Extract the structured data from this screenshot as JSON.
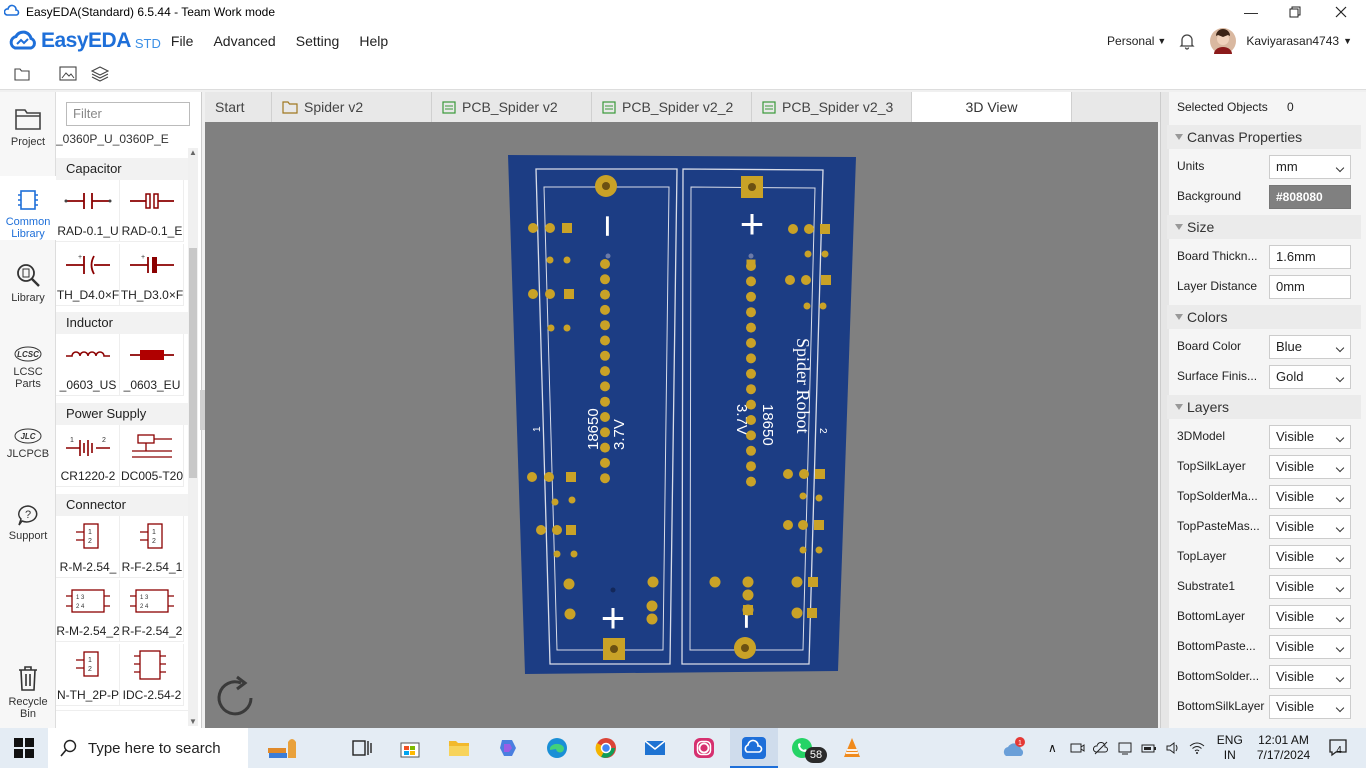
{
  "window": {
    "title": "EasyEDA(Standard) 6.5.44 - Team Work mode"
  },
  "brand": {
    "name": "EasyEDA",
    "suffix": "STD"
  },
  "menu": [
    "File",
    "Advanced",
    "Setting",
    "Help"
  ],
  "account": {
    "plan": "Personal",
    "username": "Kaviyarasan4743"
  },
  "leftnav": [
    {
      "label": "Project",
      "icon": "folder-icon"
    },
    {
      "label": "Common Library",
      "icon": "chip-icon"
    },
    {
      "label": "Library",
      "icon": "search-library-icon"
    },
    {
      "label": "LCSC Parts",
      "icon": "lcsc-icon"
    },
    {
      "label": "JLCPCB",
      "icon": "jlc-icon"
    },
    {
      "label": "Support",
      "icon": "help-icon"
    },
    {
      "label": "Recycle Bin",
      "icon": "trash-icon"
    }
  ],
  "library": {
    "filter_placeholder": "Filter",
    "top_partial": "_0360P_U_0360P_E",
    "categories": [
      "Capacitor",
      "Inductor",
      "Power Supply",
      "Connector"
    ],
    "capacitor_parts": [
      "RAD-0.1_U",
      "RAD-0.1_E",
      "TH_D4.0×F",
      "TH_D3.0×F"
    ],
    "inductor_parts": [
      "_0603_US",
      "_0603_EU"
    ],
    "power_parts": [
      "CR1220-2",
      "DC005-T20"
    ],
    "connector_parts": [
      "R-M-2.54_",
      "R-F-2.54_1",
      "R-M-2.54_2",
      "R-F-2.54_2",
      "N-TH_2P-P",
      "IDC-2.54-2"
    ]
  },
  "tabs": [
    {
      "label": "Start",
      "icon": ""
    },
    {
      "label": "Spider v2",
      "icon": "folder-icon"
    },
    {
      "label": "PCB_Spider v2",
      "icon": "pcb-icon"
    },
    {
      "label": "PCB_Spider v2_2",
      "icon": "pcb-icon"
    },
    {
      "label": "PCB_Spider v2_3",
      "icon": "pcb-icon"
    },
    {
      "label": "3D View",
      "icon": ""
    }
  ],
  "board": {
    "silk_left": {
      "num": "1",
      "cell": "18650",
      "volt": "3.7V"
    },
    "silk_right": {
      "num": "2",
      "cell": "18650",
      "volt": "3.7V",
      "name": "Spider Robot"
    },
    "minus": "−",
    "plus": "+"
  },
  "panel": {
    "selected_label": "Selected Objects",
    "selected_count": "0",
    "canvas_title": "Canvas Properties",
    "units_label": "Units",
    "units_value": "mm",
    "background_label": "Background",
    "background_value": "#808080",
    "size_title": "Size",
    "thickness_label": "Board Thickn...",
    "thickness_value": "1.6mm",
    "layerdist_label": "Layer Distance",
    "layerdist_value": "0mm",
    "colors_title": "Colors",
    "boardcolor_label": "Board Color",
    "boardcolor_value": "Blue",
    "surface_label": "Surface Finis...",
    "surface_value": "Gold",
    "layers_title": "Layers",
    "layers": [
      {
        "name": "3DModel",
        "value": "Visible"
      },
      {
        "name": "TopSilkLayer",
        "value": "Visible"
      },
      {
        "name": "TopSolderMa...",
        "value": "Visible"
      },
      {
        "name": "TopPasteMas...",
        "value": "Visible"
      },
      {
        "name": "TopLayer",
        "value": "Visible"
      },
      {
        "name": "Substrate1",
        "value": "Visible"
      },
      {
        "name": "BottomLayer",
        "value": "Visible"
      },
      {
        "name": "BottomPaste...",
        "value": "Visible"
      },
      {
        "name": "BottomSolder...",
        "value": "Visible"
      },
      {
        "name": "BottomSilkLayer",
        "value": "Visible"
      }
    ]
  },
  "taskbar": {
    "search_placeholder": "Type here to search",
    "whatsapp_badge": "58",
    "lang_top": "ENG",
    "lang_bottom": "IN",
    "time": "12:01 AM",
    "date": "7/17/2024",
    "notif_count": "4"
  },
  "colors": {
    "accent": "#1e6fd9",
    "board": "#1c3d84",
    "canvas": "#808080",
    "pad": "#c9a227"
  }
}
